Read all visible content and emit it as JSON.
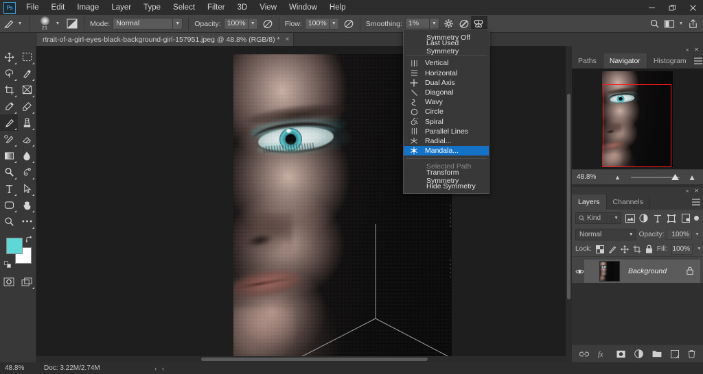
{
  "app": {
    "logo": "Ps",
    "menus": [
      "File",
      "Edit",
      "Image",
      "Layer",
      "Type",
      "Select",
      "Filter",
      "3D",
      "View",
      "Window",
      "Help"
    ],
    "window_controls": [
      "minimize-icon",
      "restore-icon",
      "close-icon"
    ]
  },
  "options_bar": {
    "tool_icon": "brush-tool-icon",
    "brush_size": "21",
    "brush_preset_icon": "brush-preset-icon",
    "mode_label": "Mode:",
    "mode_value": "Normal",
    "opacity_label": "Opacity:",
    "opacity_value": "100%",
    "opacity_pressure_icon": "pressure-opacity-icon",
    "flow_label": "Flow:",
    "flow_value": "100%",
    "airbrush_icon": "airbrush-icon",
    "smoothing_label": "Smoothing:",
    "smoothing_value": "1%",
    "smoothing_options_icon": "gear-icon",
    "angle_icon": "brush-angle-icon",
    "symmetry_icon": "symmetry-butterfly-icon",
    "right_icons": [
      "search-icon",
      "workspace-icon",
      "share-icon"
    ]
  },
  "document_tab": {
    "title": "rtrait-of-a-girl-eyes-black-background-girl-157951.jpeg @ 48.8%  (RGB/8) *",
    "close": "×"
  },
  "toolbar": {
    "tools": [
      {
        "name": "move-tool",
        "glyph": "move"
      },
      {
        "name": "rectangular-marquee-tool",
        "glyph": "marquee"
      },
      {
        "name": "lasso-tool",
        "glyph": "lasso"
      },
      {
        "name": "quick-selection-tool",
        "glyph": "quickselect"
      },
      {
        "name": "crop-tool",
        "glyph": "crop"
      },
      {
        "name": "frame-tool",
        "glyph": "frame"
      },
      {
        "name": "eyedropper-tool",
        "glyph": "eyedropper"
      },
      {
        "name": "healing-brush-tool",
        "glyph": "healing"
      },
      {
        "name": "brush-tool",
        "glyph": "brush",
        "active": true
      },
      {
        "name": "clone-stamp-tool",
        "glyph": "stamp"
      },
      {
        "name": "history-brush-tool",
        "glyph": "historybrush"
      },
      {
        "name": "eraser-tool",
        "glyph": "eraser"
      },
      {
        "name": "gradient-tool",
        "glyph": "gradient"
      },
      {
        "name": "blur-tool",
        "glyph": "blur"
      },
      {
        "name": "dodge-tool",
        "glyph": "dodge"
      },
      {
        "name": "pen-tool",
        "glyph": "pen"
      },
      {
        "name": "type-tool",
        "glyph": "type"
      },
      {
        "name": "path-selection-tool",
        "glyph": "pathselect"
      },
      {
        "name": "rectangle-tool",
        "glyph": "rectangle"
      },
      {
        "name": "hand-tool",
        "glyph": "hand"
      },
      {
        "name": "zoom-tool",
        "glyph": "zoom"
      },
      {
        "name": "edit-toolbar-tool",
        "glyph": "ellipsis"
      }
    ],
    "foreground_color": "#5fd7d7",
    "background_color": "#ffffff",
    "swap_icon": "swap-colors-icon",
    "default_colors_icon": "default-colors-icon",
    "quickmask_icon": "quick-mask-icon",
    "screenmode_icon": "screen-mode-icon"
  },
  "symmetry_menu": {
    "top_items": [
      "Symmetry Off",
      "Last Used Symmetry"
    ],
    "types": [
      {
        "label": "Vertical",
        "icon": "vertical-symmetry-icon"
      },
      {
        "label": "Horizontal",
        "icon": "horizontal-symmetry-icon"
      },
      {
        "label": "Dual Axis",
        "icon": "dual-axis-symmetry-icon"
      },
      {
        "label": "Diagonal",
        "icon": "diagonal-symmetry-icon"
      },
      {
        "label": "Wavy",
        "icon": "wavy-symmetry-icon"
      },
      {
        "label": "Circle",
        "icon": "circle-symmetry-icon"
      },
      {
        "label": "Spiral",
        "icon": "spiral-symmetry-icon"
      },
      {
        "label": "Parallel Lines",
        "icon": "parallel-lines-symmetry-icon"
      },
      {
        "label": "Radial...",
        "icon": "radial-symmetry-icon"
      },
      {
        "label": "Mandala...",
        "icon": "mandala-symmetry-icon",
        "selected": true
      }
    ],
    "section_label": "Selected Path",
    "bottom_items": [
      "Transform Symmetry",
      "Hide Symmetry"
    ],
    "highlight_color": "#1473c6"
  },
  "navigator_panel": {
    "tabs": [
      {
        "label": "Paths",
        "active": false
      },
      {
        "label": "Navigator",
        "active": true
      },
      {
        "label": "Histogram",
        "active": false
      }
    ],
    "zoom_value": "48.8%",
    "view_box_color": "#ff1a1a",
    "menu_icon": "panel-menu-icon",
    "collapse_icon": "collapse-panel-icon",
    "close_icon": "close-panel-icon"
  },
  "layers_panel": {
    "tabs": [
      {
        "label": "Layers",
        "active": true
      },
      {
        "label": "Channels",
        "active": false
      }
    ],
    "filter_placeholder": "Kind",
    "filter_icons": [
      "pixel-layer-filter-icon",
      "adjustment-layer-filter-icon",
      "type-layer-filter-icon",
      "shape-layer-filter-icon",
      "smart-object-filter-icon"
    ],
    "blend_mode": "Normal",
    "opacity_label": "Opacity:",
    "opacity_value": "100%",
    "lock_label": "Lock:",
    "lock_icons": [
      "lock-transparent-pixels-icon",
      "lock-image-pixels-icon",
      "lock-position-icon",
      "lock-artboard-icon",
      "lock-all-icon"
    ],
    "fill_label": "Fill:",
    "fill_value": "100%",
    "layers": [
      {
        "name": "Background",
        "visible": true,
        "locked": true
      }
    ],
    "bottom_icons": [
      "link-layers-icon",
      "layer-style-fx-icon",
      "add-layer-mask-icon",
      "new-adjustment-layer-icon",
      "new-group-icon",
      "new-layer-icon",
      "delete-layer-icon"
    ],
    "menu_icon": "panel-menu-icon"
  },
  "status_bar": {
    "zoom": "48.8%",
    "doc_info": "Doc: 3.22M/2.74M",
    "arrow_right": "›",
    "arrow_left": "‹"
  },
  "canvas": {
    "symmetry_guide": "mandala-3-way-radial-guide",
    "guide_color": "#b9b9b9",
    "image_alt": "portrait-of-a-girl-with-teal-eye-makeup"
  }
}
